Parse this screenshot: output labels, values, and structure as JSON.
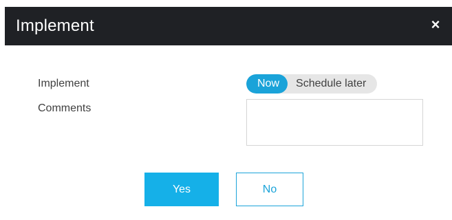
{
  "dialog": {
    "title": "Implement",
    "close_glyph": "×",
    "close_icon": "close-icon"
  },
  "form": {
    "implement_label": "Implement",
    "comments_label": "Comments",
    "implement_options": [
      "Now",
      "Schedule later"
    ],
    "implement_selected": "Now",
    "comments_value": "",
    "comments_placeholder": ""
  },
  "actions": {
    "yes_label": "Yes",
    "no_label": "No"
  },
  "colors": {
    "titlebar_bg": "#1f2125",
    "accent": "#15b0e8",
    "toggle_inactive_bg": "#e6e6e6"
  }
}
